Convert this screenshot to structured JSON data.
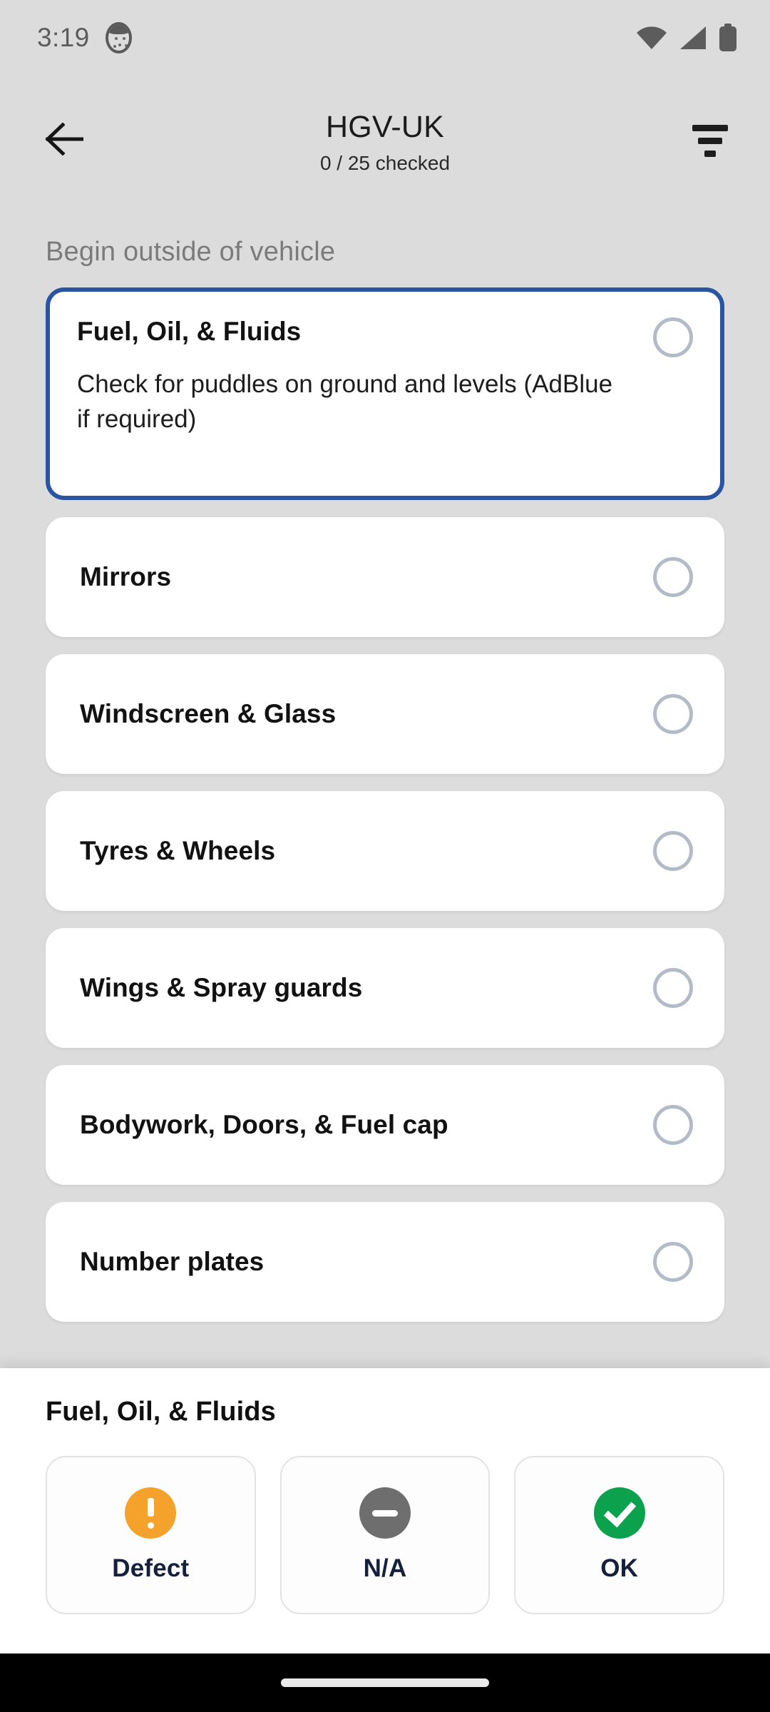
{
  "status_bar": {
    "time": "3:19",
    "pet_icon": "cat-avatar-icon",
    "icons": [
      "wifi-icon",
      "cellular-signal-icon",
      "battery-icon"
    ]
  },
  "app_bar": {
    "back_icon": "back-arrow-icon",
    "title": "HGV-UK",
    "subtitle": "0 / 25 checked",
    "filter_icon": "filter-icon"
  },
  "list": {
    "section_header": "Begin outside of vehicle",
    "items": [
      {
        "title": "Fuel, Oil, & Fluids",
        "description": "Check for puddles on ground and levels (AdBlue if required)",
        "selected": true,
        "status": "unchecked"
      },
      {
        "title": "Mirrors",
        "description": "",
        "selected": false,
        "status": "unchecked"
      },
      {
        "title": "Windscreen & Glass",
        "description": "",
        "selected": false,
        "status": "unchecked"
      },
      {
        "title": "Tyres & Wheels",
        "description": "",
        "selected": false,
        "status": "unchecked"
      },
      {
        "title": "Wings & Spray guards",
        "description": "",
        "selected": false,
        "status": "unchecked"
      },
      {
        "title": "Bodywork, Doors, & Fuel cap",
        "description": "",
        "selected": false,
        "status": "unchecked"
      },
      {
        "title": "Number plates",
        "description": "",
        "selected": false,
        "status": "unchecked"
      }
    ]
  },
  "bottom_panel": {
    "title": "Fuel, Oil, & Fluids",
    "actions": [
      {
        "label": "Defect",
        "icon": "exclamation-circle-icon",
        "color": "#f4a22b"
      },
      {
        "label": "N/A",
        "icon": "minus-circle-icon",
        "color": "#6e6e6e"
      },
      {
        "label": "OK",
        "icon": "check-circle-icon",
        "color": "#0ba14d"
      }
    ]
  },
  "nav_bar": {
    "home_indicator": "home-indicator-pill"
  },
  "colors": {
    "screen_background": "#dcdcdc",
    "card_background": "#ffffff",
    "selected_border": "#2b55a0",
    "radio_border": "#b4bbc8",
    "section_header_text": "#7b7b7b",
    "action_label_text": "#15213c",
    "nav_bar": "#000000"
  }
}
